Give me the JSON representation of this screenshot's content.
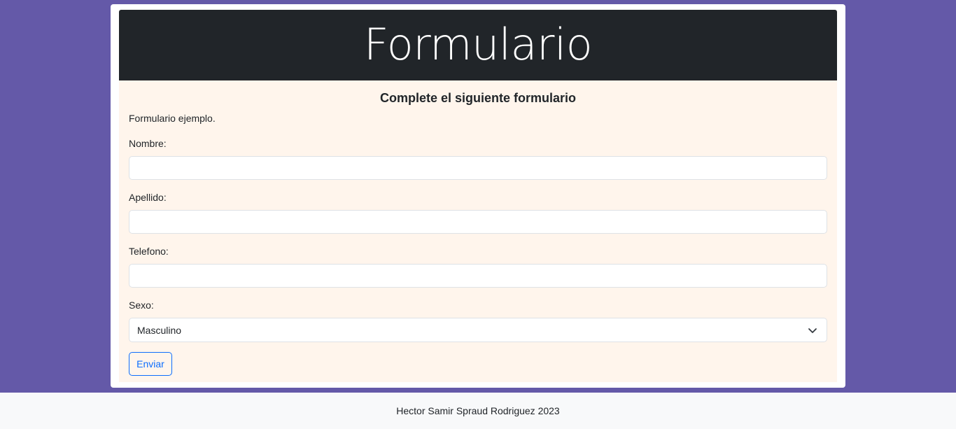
{
  "header": {
    "title": "Formulario"
  },
  "form": {
    "subtitle": "Complete el siguiente formulario",
    "description": "Formulario ejemplo.",
    "fields": [
      {
        "label": "Nombre:",
        "value": "",
        "placeholder": ""
      },
      {
        "label": "Apellido:",
        "value": "",
        "placeholder": ""
      },
      {
        "label": "Telefono:",
        "value": "",
        "placeholder": ""
      }
    ],
    "sexo": {
      "label": "Sexo:",
      "selected": "Masculino",
      "icon": "chevron-down-icon"
    },
    "submit_label": "Enviar"
  },
  "footer": {
    "text": "Hector Samir Spraud Rodriguez 2023"
  },
  "colors": {
    "page_background": "#6459a8",
    "header_background": "#212529",
    "form_background": "#fff5ec",
    "button_accent": "#0d6efd",
    "footer_background": "#f8f9fa"
  }
}
